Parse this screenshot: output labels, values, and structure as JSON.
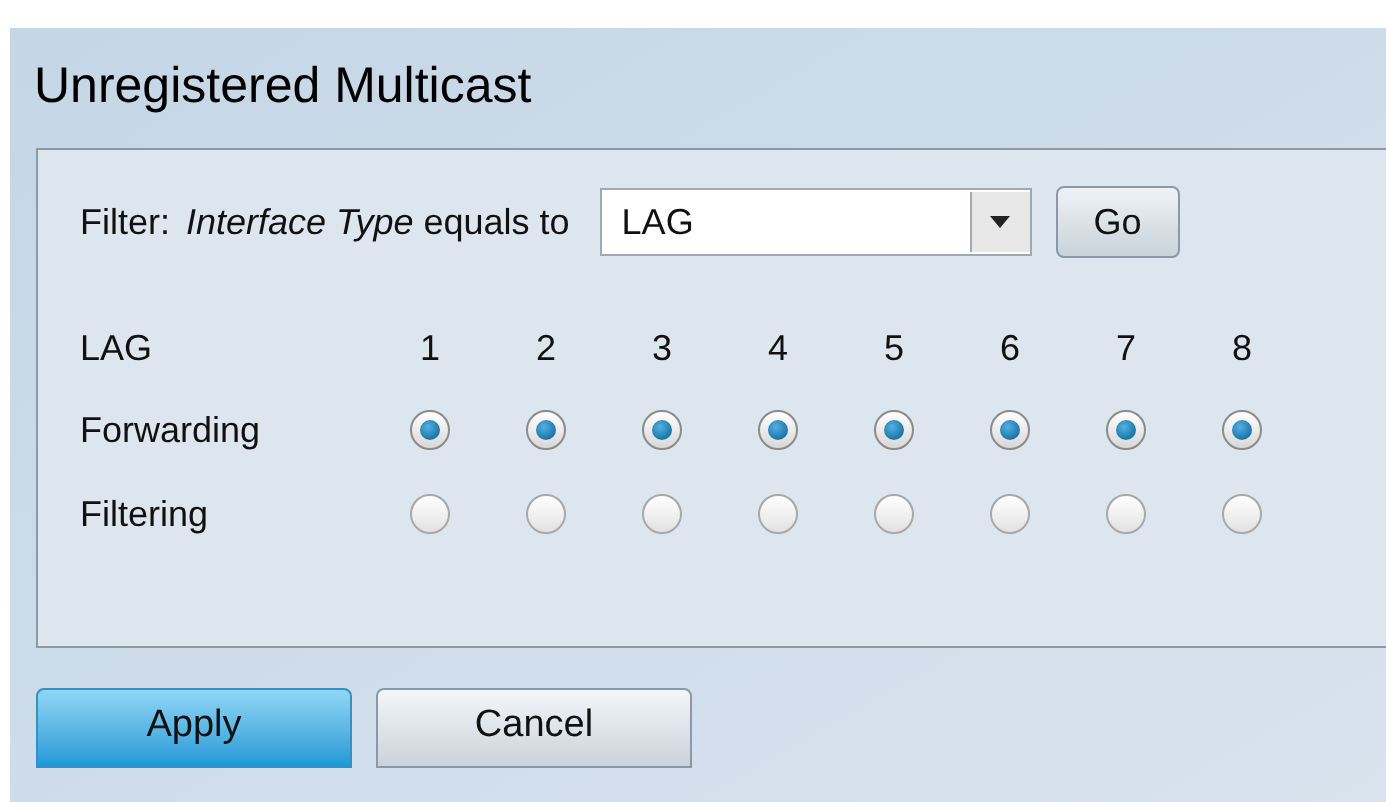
{
  "title": "Unregistered Multicast",
  "filter": {
    "label": "Filter:",
    "field_name": "Interface Type",
    "operator": "equals to",
    "value": "LAG",
    "go_button": "Go"
  },
  "header": {
    "label": "LAG",
    "ports": [
      "1",
      "2",
      "3",
      "4",
      "5",
      "6",
      "7",
      "8"
    ]
  },
  "rows": [
    {
      "label": "Forwarding",
      "cells": [
        {
          "selected": true
        },
        {
          "selected": true
        },
        {
          "selected": true
        },
        {
          "selected": true
        },
        {
          "selected": true
        },
        {
          "selected": true
        },
        {
          "selected": true
        },
        {
          "selected": true
        }
      ]
    },
    {
      "label": "Filtering",
      "cells": [
        {
          "selected": false
        },
        {
          "selected": false
        },
        {
          "selected": false
        },
        {
          "selected": false
        },
        {
          "selected": false
        },
        {
          "selected": false
        },
        {
          "selected": false
        },
        {
          "selected": false
        }
      ]
    }
  ],
  "buttons": [
    {
      "label": "Apply",
      "kind": "primary"
    },
    {
      "label": "Cancel",
      "kind": "secondary"
    }
  ]
}
